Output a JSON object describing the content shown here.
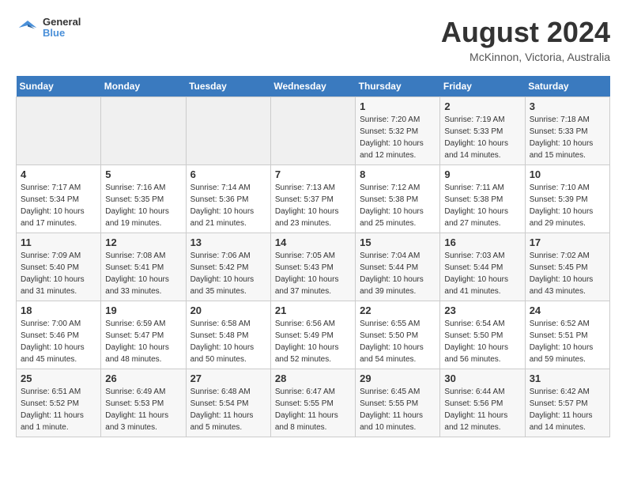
{
  "header": {
    "logo": {
      "line1": "General",
      "line2": "Blue"
    },
    "title": "August 2024",
    "location": "McKinnon, Victoria, Australia"
  },
  "calendar": {
    "days_of_week": [
      "Sunday",
      "Monday",
      "Tuesday",
      "Wednesday",
      "Thursday",
      "Friday",
      "Saturday"
    ],
    "weeks": [
      [
        {
          "day": "",
          "info": ""
        },
        {
          "day": "",
          "info": ""
        },
        {
          "day": "",
          "info": ""
        },
        {
          "day": "",
          "info": ""
        },
        {
          "day": "1",
          "info": "Sunrise: 7:20 AM\nSunset: 5:32 PM\nDaylight: 10 hours\nand 12 minutes."
        },
        {
          "day": "2",
          "info": "Sunrise: 7:19 AM\nSunset: 5:33 PM\nDaylight: 10 hours\nand 14 minutes."
        },
        {
          "day": "3",
          "info": "Sunrise: 7:18 AM\nSunset: 5:33 PM\nDaylight: 10 hours\nand 15 minutes."
        }
      ],
      [
        {
          "day": "4",
          "info": "Sunrise: 7:17 AM\nSunset: 5:34 PM\nDaylight: 10 hours\nand 17 minutes."
        },
        {
          "day": "5",
          "info": "Sunrise: 7:16 AM\nSunset: 5:35 PM\nDaylight: 10 hours\nand 19 minutes."
        },
        {
          "day": "6",
          "info": "Sunrise: 7:14 AM\nSunset: 5:36 PM\nDaylight: 10 hours\nand 21 minutes."
        },
        {
          "day": "7",
          "info": "Sunrise: 7:13 AM\nSunset: 5:37 PM\nDaylight: 10 hours\nand 23 minutes."
        },
        {
          "day": "8",
          "info": "Sunrise: 7:12 AM\nSunset: 5:38 PM\nDaylight: 10 hours\nand 25 minutes."
        },
        {
          "day": "9",
          "info": "Sunrise: 7:11 AM\nSunset: 5:38 PM\nDaylight: 10 hours\nand 27 minutes."
        },
        {
          "day": "10",
          "info": "Sunrise: 7:10 AM\nSunset: 5:39 PM\nDaylight: 10 hours\nand 29 minutes."
        }
      ],
      [
        {
          "day": "11",
          "info": "Sunrise: 7:09 AM\nSunset: 5:40 PM\nDaylight: 10 hours\nand 31 minutes."
        },
        {
          "day": "12",
          "info": "Sunrise: 7:08 AM\nSunset: 5:41 PM\nDaylight: 10 hours\nand 33 minutes."
        },
        {
          "day": "13",
          "info": "Sunrise: 7:06 AM\nSunset: 5:42 PM\nDaylight: 10 hours\nand 35 minutes."
        },
        {
          "day": "14",
          "info": "Sunrise: 7:05 AM\nSunset: 5:43 PM\nDaylight: 10 hours\nand 37 minutes."
        },
        {
          "day": "15",
          "info": "Sunrise: 7:04 AM\nSunset: 5:44 PM\nDaylight: 10 hours\nand 39 minutes."
        },
        {
          "day": "16",
          "info": "Sunrise: 7:03 AM\nSunset: 5:44 PM\nDaylight: 10 hours\nand 41 minutes."
        },
        {
          "day": "17",
          "info": "Sunrise: 7:02 AM\nSunset: 5:45 PM\nDaylight: 10 hours\nand 43 minutes."
        }
      ],
      [
        {
          "day": "18",
          "info": "Sunrise: 7:00 AM\nSunset: 5:46 PM\nDaylight: 10 hours\nand 45 minutes."
        },
        {
          "day": "19",
          "info": "Sunrise: 6:59 AM\nSunset: 5:47 PM\nDaylight: 10 hours\nand 48 minutes."
        },
        {
          "day": "20",
          "info": "Sunrise: 6:58 AM\nSunset: 5:48 PM\nDaylight: 10 hours\nand 50 minutes."
        },
        {
          "day": "21",
          "info": "Sunrise: 6:56 AM\nSunset: 5:49 PM\nDaylight: 10 hours\nand 52 minutes."
        },
        {
          "day": "22",
          "info": "Sunrise: 6:55 AM\nSunset: 5:50 PM\nDaylight: 10 hours\nand 54 minutes."
        },
        {
          "day": "23",
          "info": "Sunrise: 6:54 AM\nSunset: 5:50 PM\nDaylight: 10 hours\nand 56 minutes."
        },
        {
          "day": "24",
          "info": "Sunrise: 6:52 AM\nSunset: 5:51 PM\nDaylight: 10 hours\nand 59 minutes."
        }
      ],
      [
        {
          "day": "25",
          "info": "Sunrise: 6:51 AM\nSunset: 5:52 PM\nDaylight: 11 hours\nand 1 minute."
        },
        {
          "day": "26",
          "info": "Sunrise: 6:49 AM\nSunset: 5:53 PM\nDaylight: 11 hours\nand 3 minutes."
        },
        {
          "day": "27",
          "info": "Sunrise: 6:48 AM\nSunset: 5:54 PM\nDaylight: 11 hours\nand 5 minutes."
        },
        {
          "day": "28",
          "info": "Sunrise: 6:47 AM\nSunset: 5:55 PM\nDaylight: 11 hours\nand 8 minutes."
        },
        {
          "day": "29",
          "info": "Sunrise: 6:45 AM\nSunset: 5:55 PM\nDaylight: 11 hours\nand 10 minutes."
        },
        {
          "day": "30",
          "info": "Sunrise: 6:44 AM\nSunset: 5:56 PM\nDaylight: 11 hours\nand 12 minutes."
        },
        {
          "day": "31",
          "info": "Sunrise: 6:42 AM\nSunset: 5:57 PM\nDaylight: 11 hours\nand 14 minutes."
        }
      ]
    ]
  }
}
